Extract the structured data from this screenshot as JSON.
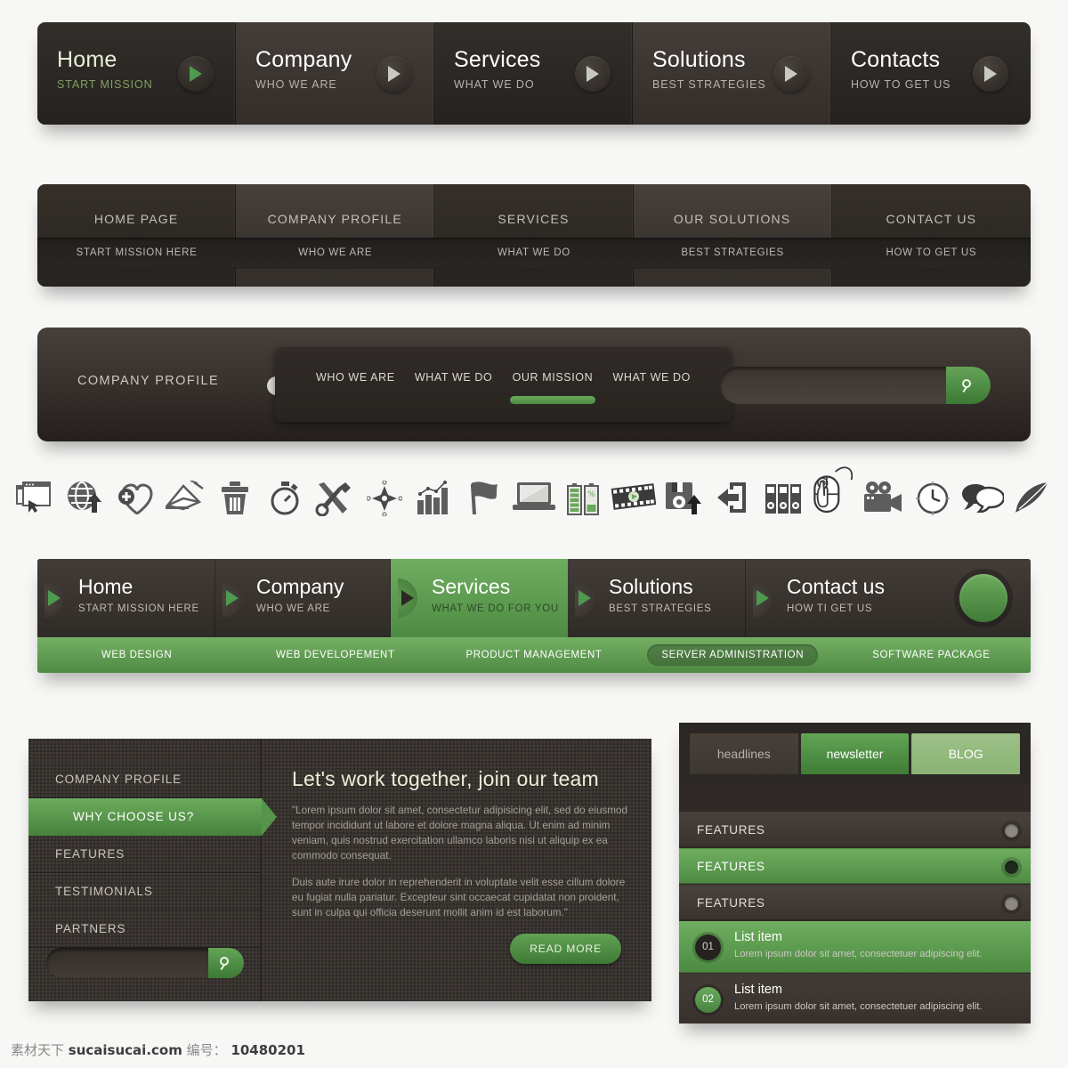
{
  "bar1": {
    "items": [
      {
        "title": "Home",
        "sub": "START MISSION",
        "active": true
      },
      {
        "title": "Company",
        "sub": "WHO WE ARE",
        "active": false
      },
      {
        "title": "Services",
        "sub": "WHAT WE DO",
        "active": false
      },
      {
        "title": "Solutions",
        "sub": "BEST STRATEGIES",
        "active": false
      },
      {
        "title": "Contacts",
        "sub": "HOW TO GET US",
        "active": false
      }
    ]
  },
  "bar2": {
    "items": [
      {
        "label": "HOME PAGE",
        "sub": "START MISSION HERE",
        "dot": "grey"
      },
      {
        "label": "COMPANY PROFILE",
        "sub": "WHO WE ARE",
        "dot": "grey"
      },
      {
        "label": "SERVICES",
        "sub": "WHAT WE DO",
        "dot": "grey"
      },
      {
        "label": "OUR SOLUTIONS",
        "sub": "BEST STRATEGIES",
        "dot": "green"
      },
      {
        "label": "CONTACT US",
        "sub": "HOW TO GET US",
        "dot": "grey"
      }
    ]
  },
  "bar3": {
    "brand": "COMPANY PROFILE",
    "items": [
      {
        "label": "WHO WE ARE",
        "active": false
      },
      {
        "label": "WHAT WE DO",
        "active": false
      },
      {
        "label": "OUR MISSION",
        "active": true
      },
      {
        "label": "WHAT WE DO",
        "active": false
      }
    ],
    "search": {
      "value": "",
      "placeholder": ""
    }
  },
  "icons": [
    "browser-window-cursor-icon",
    "globe-upload-icon",
    "heart-add-icon",
    "mail-send-icon",
    "trash-icon",
    "stopwatch-icon",
    "tools-wrench-screwdriver-icon",
    "compass-icon",
    "bar-chart-icon",
    "flag-icon",
    "laptop-icon",
    "battery-icon",
    "film-strip-icon",
    "floppy-save-icon",
    "exit-door-icon",
    "binders-icon",
    "mouse-click-icon",
    "video-camera-icon",
    "clock-icon",
    "speech-bubbles-icon",
    "feather-quill-icon"
  ],
  "bar4": {
    "items": [
      {
        "title": "Home",
        "sub": "START MISSION HERE",
        "active": false
      },
      {
        "title": "Company",
        "sub": "WHO WE ARE",
        "active": false
      },
      {
        "title": "Services",
        "sub": "WHAT WE DO FOR YOU",
        "active": true
      },
      {
        "title": "Solutions",
        "sub": "BEST STRATEGIES",
        "active": false
      },
      {
        "title": "Contact us",
        "sub": "HOW TI GET US",
        "active": false
      }
    ],
    "subitems": [
      {
        "label": "WEB DESIGN",
        "active": false
      },
      {
        "label": "WEB DEVELOPEMENT",
        "active": false
      },
      {
        "label": "PRODUCT MANAGEMENT",
        "active": false
      },
      {
        "label": "SERVER ADMINISTRATION",
        "active": true
      },
      {
        "label": "SOFTWARE PACKAGE",
        "active": false
      }
    ]
  },
  "panel_left": {
    "menu": [
      {
        "label": "COMPANY PROFILE",
        "active": false
      },
      {
        "label": "WHY CHOOSE US?",
        "active": true
      },
      {
        "label": "FEATURES",
        "active": false
      },
      {
        "label": "TESTIMONIALS",
        "active": false
      },
      {
        "label": "PARTNERS",
        "active": false
      }
    ],
    "search": {
      "value": "",
      "placeholder": ""
    },
    "heading": "Let's work together, join our team",
    "paragraph1": "\"Lorem ipsum dolor sit amet, consectetur adipisicing elit, sed do eiusmod tempor incididunt ut labore et dolore magna aliqua. Ut enim ad minim veniam, quis nostrud exercitation ullamco laboris nisi ut aliquip ex ea commodo consequat.",
    "paragraph2": "Duis aute irure dolor in reprehenderit in voluptate velit esse cillum dolore eu fugiat nulla pariatur. Excepteur sint occaecat cupidatat non proident, sunt in culpa qui officia deserunt mollit anim id est laborum.\"",
    "read_more": "READ MORE"
  },
  "panel_right": {
    "tabs": [
      {
        "label": "headlines",
        "state": "inactive"
      },
      {
        "label": "newsletter",
        "state": "active"
      },
      {
        "label": "BLOG",
        "state": "light"
      }
    ],
    "accordion": [
      {
        "label": "FEATURES",
        "active": false
      },
      {
        "label": "FEATURES",
        "active": true
      },
      {
        "label": "FEATURES",
        "active": false
      }
    ],
    "list": [
      {
        "num": "01",
        "title": "List item",
        "desc": "Lorem ipsum dolor sit amet, consectetuer adipiscing elit.",
        "active": true
      },
      {
        "num": "02",
        "title": "List item",
        "desc": "Lorem ipsum dolor sit amet, consectetuer adipiscing elit.",
        "active": false
      }
    ]
  },
  "footer": {
    "cn": "素材天下",
    "site": "sucaisucai.com",
    "label": "编号：",
    "number": "10480201"
  },
  "colors": {
    "accent_green": "#5f9a52",
    "dark_brown": "#2e2a27",
    "panel_brown": "#393430"
  }
}
